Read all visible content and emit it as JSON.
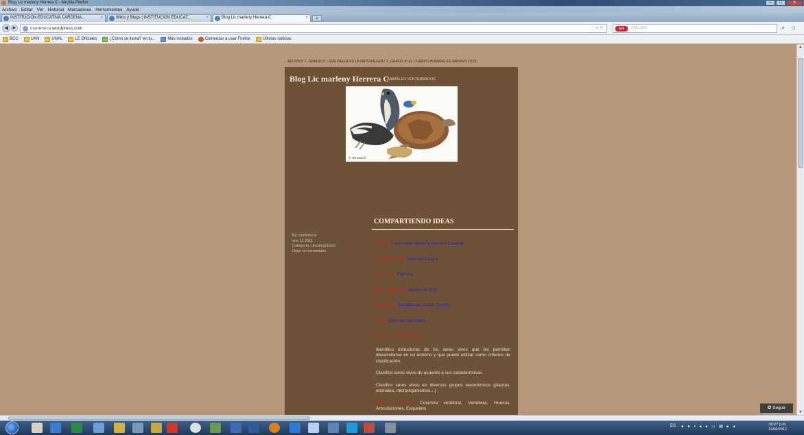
{
  "window": {
    "title": "Blog Lic marleny Herrera C - Mozilla Firefox"
  },
  "menu": [
    "Archivo",
    "Editar",
    "Ver",
    "Historial",
    "Marcadores",
    "Herramientas",
    "Ayuda"
  ],
  "tabs": [
    {
      "label": "INSTITUCION EDUCATIVA CARDENA...",
      "active": false
    },
    {
      "label": "Wikis y Blogs | INSTITUCION EDUCAT...",
      "active": false
    },
    {
      "label": "Blog Lic marleny Herrera C",
      "active": true
    }
  ],
  "nav": {
    "url_prefix": "marleheca.",
    "url_domain": "wordpress.com",
    "search_placeholder": "Ask.com",
    "search_engine": "Ask"
  },
  "bookmarks": [
    "BCC",
    "UAN",
    "UNAL",
    "LE Oficiales",
    "¿Cómo se llama? en tu...",
    "Más visitados",
    "Comenzar a usar Firefox",
    "Últimas noticias"
  ],
  "blog": {
    "top_nav": "ARCHIVO   1. GRADO 5º / QUE BELLA ES LA NATURALEZA !   2. GRADO 4º EL CUERPO HUMANO ES MARAVILLOSO",
    "title": "Blog Lic marleny Herrera C",
    "tagline": "ANIMALES VERTEBRADOS",
    "image_credit": "© JW Dasch",
    "post": {
      "title": "COMPARTIENDO IDEAS",
      "meta": [
        "By: marleheca",
        "ene 11 2011",
        "Categoría: Uncategorized",
        "Dejar un comentario"
      ],
      "fields": [
        {
          "label": "Autora:",
          "value": "Licenciada Marleny Herrera Castedo"
        },
        {
          "label": "Departamento:",
          "value": "Valle del Cauca"
        },
        {
          "label": "Municipio:",
          "value": "Palmira"
        },
        {
          "label": "Fecha de inicio:",
          "value": "Marzo  04  2011"
        },
        {
          "label": "Población:",
          "value": "Estudiantes Grado Quinto"
        },
        {
          "label": "Área:",
          "value": "Ciencias Naturales"
        }
      ],
      "section_label": "Logros o Competencias:",
      "paragraphs": [
        "Identifico estructuras de los seres vivos que les permiten desarrollarse en un entorno y que puedo utilizar como criterios de clasificación.",
        "Clasifico seres vivos de acuerdo a sus características.",
        "Clasifico seres vivos en diversos grupos taxonómicos (plantas, animales, microorganismos…)"
      ],
      "keywords_label": "Palabras Claves:",
      "keywords": "Columna vertebral,  Vertebras, Huesos,  Articulaciones, Esqueleto."
    },
    "follow_label": "Seguir"
  },
  "taskbar": {
    "lang": "ES",
    "time": "09:27 p.m.",
    "date": "11/06/2012"
  },
  "colors": {
    "page_bg": "#b6977a",
    "blog_bg": "#6e5237",
    "label_red": "#d61d1d",
    "value_blue": "#2320c4"
  }
}
